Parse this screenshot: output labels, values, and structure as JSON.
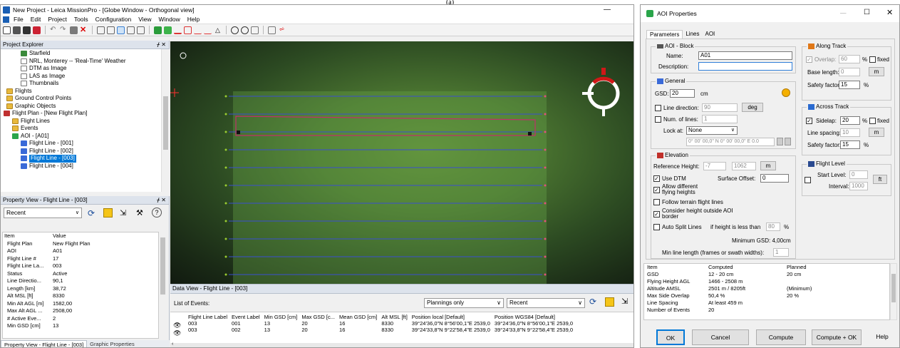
{
  "caption": "(a)",
  "main_window": {
    "title": "New Project - Leica MissionPro - [Globe Window - Orthogonal view]",
    "menu": [
      "File",
      "Edit",
      "Project",
      "Tools",
      "Configuration",
      "View",
      "Window",
      "Help"
    ],
    "project_explorer": {
      "title": "Project Explorer",
      "items": [
        {
          "label": "Starfield",
          "icon": "layer-icon"
        },
        {
          "label": "NRL, Monterey -- 'Real-Time' Weather",
          "icon": "file-icon"
        },
        {
          "label": "DTM as Image",
          "icon": "file-icon"
        },
        {
          "label": "LAS as Image",
          "icon": "file-icon"
        },
        {
          "label": "Thumbnails",
          "icon": "file-icon"
        },
        {
          "label": "Flights",
          "icon": "folder-icon"
        },
        {
          "label": "Ground Control Points",
          "icon": "folder-icon"
        },
        {
          "label": "Graphic Objects",
          "icon": "folder-icon"
        },
        {
          "label": "Flight Plan - [New Flight Plan]",
          "icon": "flight-plan-icon"
        },
        {
          "label": "Flight Lines",
          "icon": "folder-icon"
        },
        {
          "label": "Events",
          "icon": "folder-icon"
        },
        {
          "label": "AOI - [A01]",
          "icon": "aoi-icon"
        },
        {
          "label": "Flight Line - [001]",
          "icon": "flight-line-icon"
        },
        {
          "label": "Flight Line - [002]",
          "icon": "flight-line-icon"
        },
        {
          "label": "Flight Line - [003]",
          "icon": "flight-line-icon",
          "selected": true
        },
        {
          "label": "Flight Line - [004]",
          "icon": "flight-line-icon"
        }
      ]
    },
    "property_view": {
      "title": "Property View - Flight Line - [003]",
      "dropdown": "Recent",
      "header": {
        "key": "Item",
        "value": "Value"
      },
      "rows": [
        {
          "key": "Flight Plan",
          "value": "New Flight Plan"
        },
        {
          "key": "AOI",
          "value": "A01"
        },
        {
          "key": "Flight Line #",
          "value": "17"
        },
        {
          "key": "Flight Line La...",
          "value": "003"
        },
        {
          "key": "Status",
          "value": "Active"
        },
        {
          "key": "Line Directio...",
          "value": "90,1"
        },
        {
          "key": "Length [km]",
          "value": "38,72"
        },
        {
          "key": "Alt MSL [ft]",
          "value": "8330"
        },
        {
          "key": "Min Alt AGL [m]",
          "value": "1582,00"
        },
        {
          "key": "Max Alt AGL ...",
          "value": "2508,00"
        },
        {
          "key": "# Active Eve...",
          "value": "2"
        },
        {
          "key": "Min GSD [cm]",
          "value": "13"
        }
      ],
      "tabs": [
        "Property View - Flight Line - [003]",
        "Graphic Properties"
      ]
    },
    "data_view": {
      "title": "Data View - Flight Line - [003]",
      "list_label": "List of Events:",
      "filter1": "Plannings only",
      "filter2": "Recent",
      "columns": [
        "Flight Line Label",
        "Event Label",
        "Min GSD [cm]",
        "Max GSD [c...",
        "Mean GSD [cm]",
        "Alt MSL [ft]",
        "Position local [Default]",
        "Position WGS84 [Default]"
      ],
      "rows": [
        [
          "003",
          "001",
          "13",
          "20",
          "16",
          "8330",
          "39°24'36,0\"N 8°56'00,1\"E 2539,0",
          "39°24'36,0\"N 8°56'00,1\"E 2539,0"
        ],
        [
          "003",
          "002",
          "13",
          "20",
          "16",
          "8330",
          "39°24'33,8\"N 9°22'58,4\"E 2539,0",
          "39°24'33,8\"N 9°22'58,4\"E 2539,0"
        ]
      ]
    }
  },
  "aoi_dialog": {
    "title": "AOI Properties",
    "tabs": [
      "Parameters",
      "Lines",
      "AOI"
    ],
    "aoi_block": {
      "title": "AOI - Block",
      "name_label": "Name:",
      "name_value": "A01",
      "description_label": "Description:",
      "description_value": ""
    },
    "general": {
      "title": "General",
      "gsd_label": "GSD:",
      "gsd_value": "20",
      "gsd_unit": "cm",
      "line_direction_label": "Line direction:",
      "line_direction_value": "90",
      "line_direction_unit": "deg",
      "num_lines_label": "Num. of lines:",
      "num_lines_value": "1",
      "lock_at_label": "Lock at:",
      "lock_at_value": "None",
      "coord_value": "0° 00' 00,0\" N 0° 00' 00,0\" E 0.0"
    },
    "elevation": {
      "title": "Elevation",
      "ref_height_label": "Reference Height:",
      "ref_height_value": "-7",
      "ref_height_value2": "1062",
      "ref_height_unit": "m",
      "use_dtm_label": "Use DTM",
      "surface_offset_label": "Surface Offset:",
      "surface_offset_value": "0",
      "allow_diff_label": "Allow different flying heights",
      "follow_terrain_label": "Follow terrain flight lines",
      "consider_height_label": "Consider height outside AOI border",
      "auto_split_label": "Auto Split Lines",
      "if_height_label": "if height is less than",
      "if_height_value": "80",
      "if_height_unit": "%",
      "min_gsd_label": "Minimum GSD: 4,00cm",
      "min_line_label": "Min line length (frames or swath widths):",
      "min_line_value": "1"
    },
    "along_track": {
      "title": "Along Track",
      "overlap_label": "Overlap:",
      "overlap_value": "60",
      "overlap_unit": "%",
      "fixed_label": "fixed",
      "base_length_label": "Base length:",
      "base_length_value": "0",
      "base_length_unit": "m",
      "safety_label": "Safety factor:",
      "safety_value": "15",
      "safety_unit": "%"
    },
    "across_track": {
      "title": "Across Track",
      "sidelap_label": "Sidelap:",
      "sidelap_value": "20",
      "sidelap_unit": "%",
      "fixed_label": "fixed",
      "line_spacing_label": "Line spacing:",
      "line_spacing_value": "10",
      "line_spacing_unit": "m",
      "safety_label": "Safety factor:",
      "safety_value": "15",
      "safety_unit": "%"
    },
    "flight_level": {
      "title": "Flight Level",
      "start_label": "Start Level:",
      "start_value": "0",
      "start_unit": "ft",
      "interval_label": "Interval:",
      "interval_value": "1000"
    },
    "computed": {
      "header": [
        "Item",
        "Computed",
        "Planned"
      ],
      "rows": [
        [
          "GSD",
          "12 - 20 cm",
          "20 cm"
        ],
        [
          "Flying Height AGL",
          "1466 - 2508 m",
          ""
        ],
        [
          "Altitude AMSL",
          "2501 m / 8205ft",
          "(Minimum)"
        ],
        [
          "Max Side Overlap",
          "50,4 %",
          "20 %"
        ],
        [
          "Line Spacing",
          "At least 459 m",
          ""
        ],
        [
          "Number of Events",
          "20",
          ""
        ]
      ]
    },
    "buttons": {
      "ok": "OK",
      "cancel": "Cancel",
      "compute": "Compute",
      "compute_ok": "Compute + OK",
      "help": "Help"
    }
  },
  "colors": {
    "flight_line": "#3a4fd0",
    "aoi_border": "#c0306a",
    "selected": "#0078d7",
    "compass_red": "#d01818"
  }
}
